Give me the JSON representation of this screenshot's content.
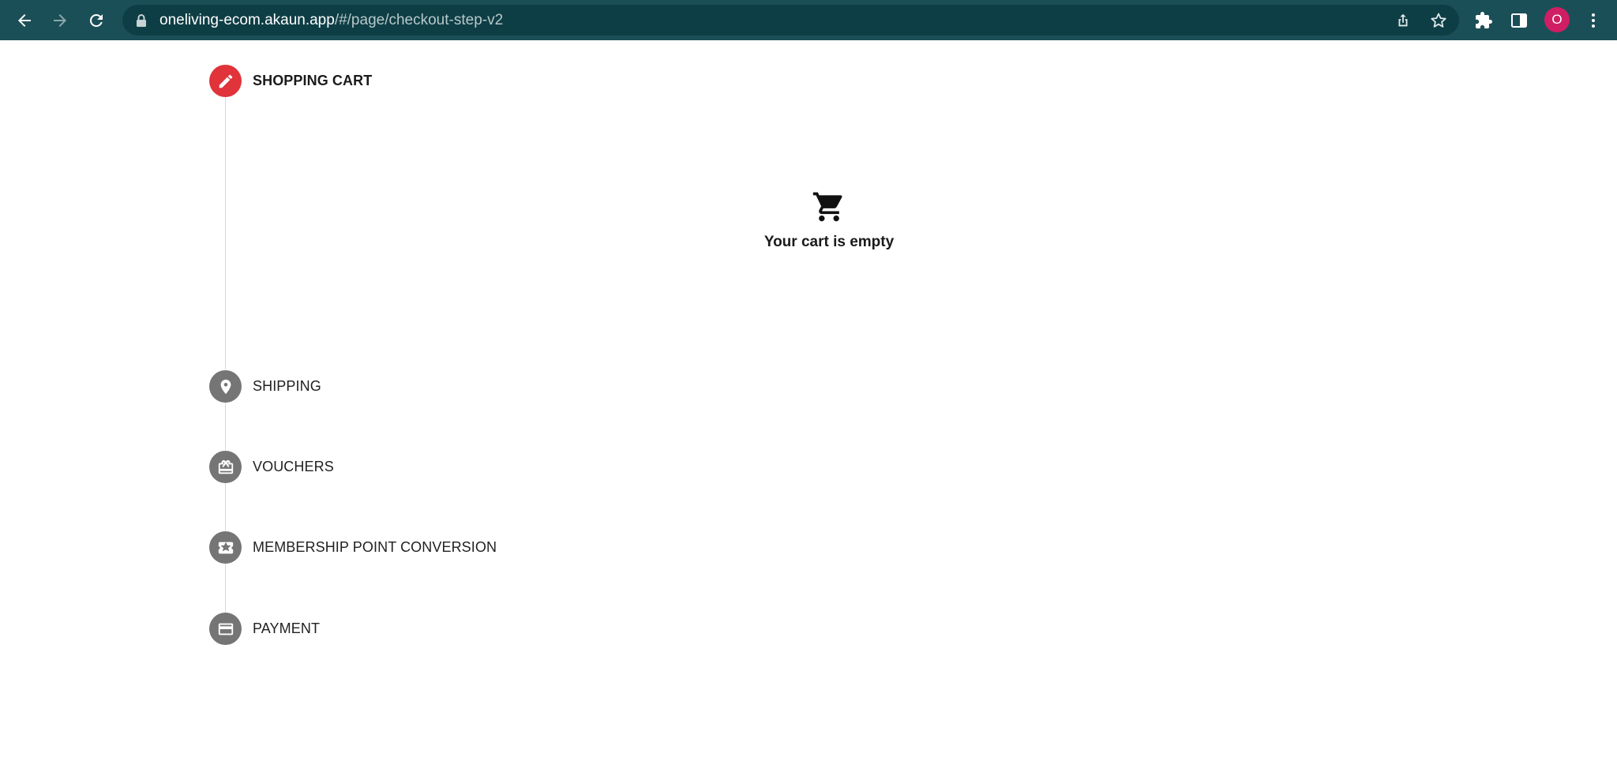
{
  "browser": {
    "url_host": "oneliving-ecom.akaun.app",
    "url_path": "/#/page/checkout-step-v2",
    "profile_initial": "O",
    "icons": {
      "back": "back-arrow-icon",
      "forward": "forward-arrow-icon",
      "reload": "reload-icon",
      "lock": "lock-icon",
      "share": "share-icon",
      "bookmark": "star-icon",
      "extensions": "puzzle-icon",
      "side_panel": "side-panel-icon",
      "menu": "kebab-menu-icon"
    },
    "colors": {
      "toolbar": "#1b4f57",
      "omnibox": "#0e3e45",
      "avatar": "#cf1e63"
    }
  },
  "stepper": {
    "steps": [
      {
        "label": "SHOPPING CART",
        "icon": "pencil-icon",
        "active": true
      },
      {
        "label": "SHIPPING",
        "icon": "location-pin-icon",
        "active": false
      },
      {
        "label": "VOUCHERS",
        "icon": "gift-card-icon",
        "active": false
      },
      {
        "label": "MEMBERSHIP POINT CONVERSION",
        "icon": "star-ticket-icon",
        "active": false
      },
      {
        "label": "PAYMENT",
        "icon": "credit-card-icon",
        "active": false
      }
    ],
    "colors": {
      "active": "#e0333a",
      "inactive": "#757575"
    }
  },
  "cart": {
    "empty_message": "Your cart is empty",
    "icon": "shopping-cart-icon"
  }
}
